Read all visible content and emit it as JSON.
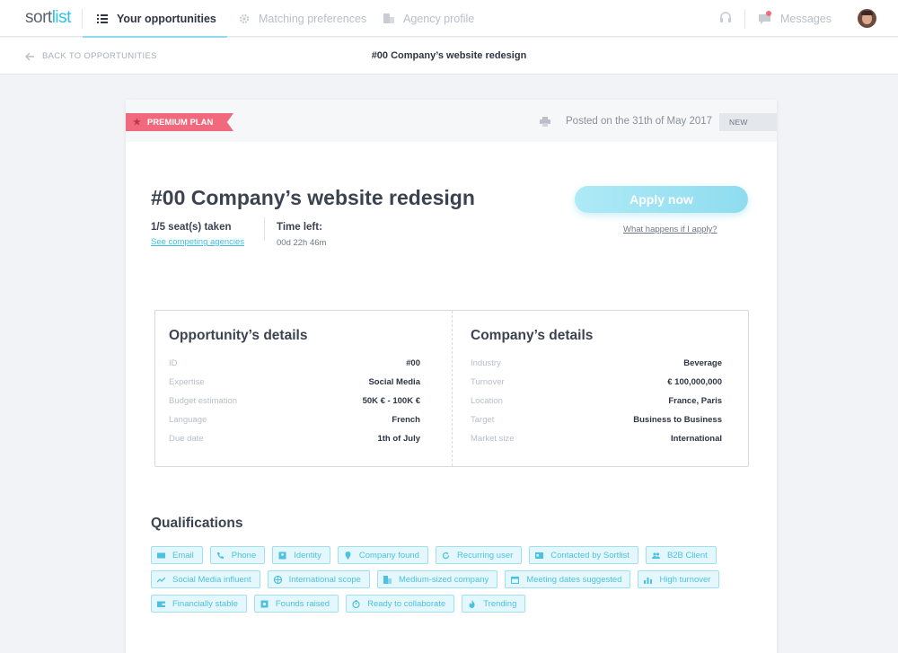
{
  "nav": {
    "logo_pre": "sort",
    "logo_post": "list",
    "tabs": [
      {
        "label": "Your opportunities",
        "icon": "list-icon",
        "active": true
      },
      {
        "label": "Matching preferences",
        "icon": "gear-icon",
        "active": false
      },
      {
        "label": "Agency profile",
        "icon": "building-icon",
        "active": false
      }
    ],
    "messages_label": "Messages"
  },
  "subbar": {
    "back_label": "BACK TO OPPORTUNITIES",
    "title": "#00 Company’s website redesign"
  },
  "card": {
    "plan_label": "PREMIUM PLAN",
    "posted": "Posted on the 31th of May 2017",
    "status": "NEW",
    "title": "#00 Company’s website redesign",
    "seats": "1/5 seat(s) taken",
    "competing_link": "See competing agencies",
    "time_left_label": "Time left:",
    "time_left_value": "00d 22h 46m",
    "apply_label": "Apply now",
    "what_happens": "What happens if I apply?"
  },
  "opportunity": {
    "title": "Opportunity’s details",
    "rows": [
      {
        "k": "ID",
        "v": "#00"
      },
      {
        "k": "Expertise",
        "v": "Social Media"
      },
      {
        "k": "Budget estimation",
        "v": "50K € - 100K €"
      },
      {
        "k": "Language",
        "v": "French"
      },
      {
        "k": "Due date",
        "v": "1th of July"
      }
    ]
  },
  "company": {
    "title": "Company’s details",
    "rows": [
      {
        "k": "Industry",
        "v": "Beverage"
      },
      {
        "k": "Turnover",
        "v": "€ 100,000,000"
      },
      {
        "k": "Location",
        "v": "France, Paris"
      },
      {
        "k": "Target",
        "v": "Business to Business"
      },
      {
        "k": "Market size",
        "v": "International"
      }
    ]
  },
  "qualifications": {
    "title": "Qualifications",
    "rows": [
      [
        {
          "label": "Email",
          "icon": "envelope-icon"
        },
        {
          "label": "Phone",
          "icon": "phone-icon"
        },
        {
          "label": "Identity",
          "icon": "id-card-icon"
        },
        {
          "label": "Company found",
          "icon": "map-pin-icon"
        },
        {
          "label": "Recurring user",
          "icon": "refresh-icon"
        },
        {
          "label": "Contacted by Sortlist",
          "icon": "contact-card-icon"
        },
        {
          "label": "B2B Client",
          "icon": "people-icon"
        }
      ],
      [
        {
          "label": "Social Media influent",
          "icon": "trend-icon"
        },
        {
          "label": "International scope",
          "icon": "globe-icon"
        },
        {
          "label": "Medium-sized company",
          "icon": "building-icon"
        },
        {
          "label": "Meeting dates suggested",
          "icon": "calendar-icon"
        },
        {
          "label": "High turnover",
          "icon": "bar-chart-icon"
        }
      ],
      [
        {
          "label": "Financially stable",
          "icon": "wallet-icon"
        },
        {
          "label": "Founds raised",
          "icon": "money-icon"
        },
        {
          "label": "Ready to collaborate",
          "icon": "stopwatch-icon"
        },
        {
          "label": "Trending",
          "icon": "flame-icon"
        }
      ]
    ]
  },
  "colors": {
    "accent": "#2cc3e8",
    "tag_text": "#4cc2e0",
    "premium": "#f0697c"
  }
}
